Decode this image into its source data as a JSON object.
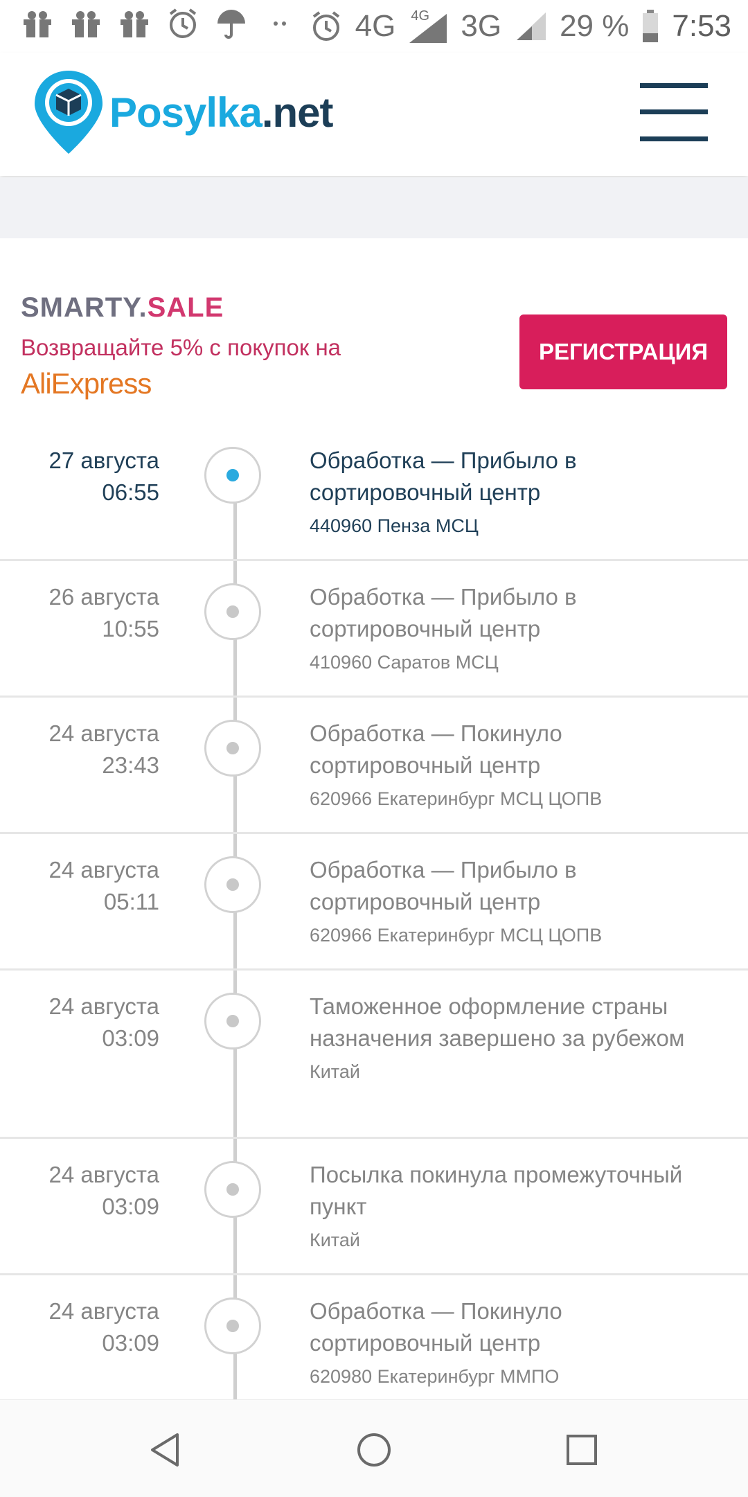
{
  "status_bar": {
    "network": "4G",
    "network_small": "4G",
    "network2": "3G",
    "battery": "29 %",
    "time": "7:53"
  },
  "header": {
    "logo_part1": "Posylka",
    "logo_part2": ".net"
  },
  "banner": {
    "brand_part1": "SMARTY.",
    "brand_part2": "SALE",
    "cashback_text": "Возвращайте 5% с покупок на",
    "store": "AliExpress",
    "register_label": "РЕГИСТРАЦИЯ"
  },
  "events": [
    {
      "date": "27 августа",
      "time": "06:55",
      "title": "Обработка — Прибыло в сортировочный центр",
      "location": "440960 Пенза МСЦ"
    },
    {
      "date": "26 августа",
      "time": "10:55",
      "title": "Обработка — Прибыло в сортировочный центр",
      "location": "410960 Саратов МСЦ"
    },
    {
      "date": "24 августа",
      "time": "23:43",
      "title": "Обработка — Покинуло сортировочный центр",
      "location": "620966 Екатеринбург МСЦ ЦОПВ"
    },
    {
      "date": "24 августа",
      "time": "05:11",
      "title": "Обработка — Прибыло в сортировочный центр",
      "location": "620966 Екатеринбург МСЦ ЦОПВ"
    },
    {
      "date": "24 августа",
      "time": "03:09",
      "title": "Таможенное оформление страны назначения завершено за рубежом",
      "location": "Китай"
    },
    {
      "date": "24 августа",
      "time": "03:09",
      "title": "Посылка покинула промежуточный пункт",
      "location": "Китай"
    },
    {
      "date": "24 августа",
      "time": "03:09",
      "title": "Обработка — Покинуло сортировочный центр",
      "location": "620980 Екатеринбург ММПО"
    }
  ]
}
